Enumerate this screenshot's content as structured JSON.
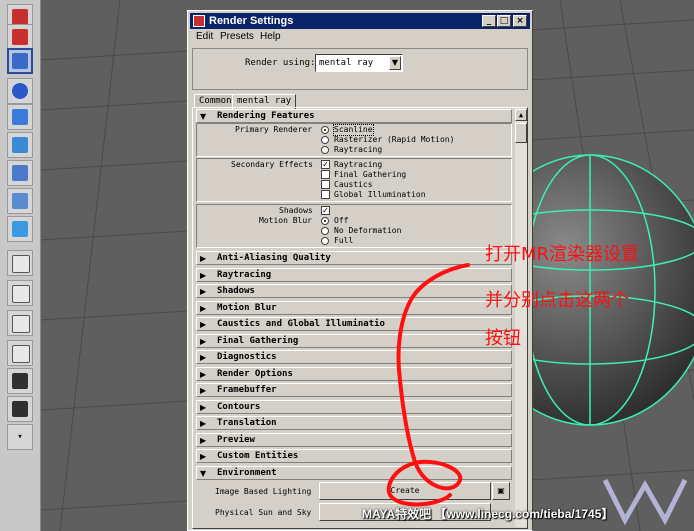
{
  "window": {
    "title": "Render Settings",
    "min_label": "_",
    "max_label": "□",
    "close_label": "×"
  },
  "menu": [
    "Edit",
    "Presets",
    "Help"
  ],
  "render_using": {
    "label": "Render using:",
    "value": "mental ray"
  },
  "tabs": [
    {
      "label": "Common",
      "active": false
    },
    {
      "label": "mental ray",
      "active": true
    }
  ],
  "rendering_features": {
    "title": "Rendering Features",
    "primary_label": "Primary Renderer",
    "primary_options": [
      {
        "label": "Scanline",
        "selected": true
      },
      {
        "label": "Rasterizer (Rapid Motion)",
        "selected": false
      },
      {
        "label": "Raytracing",
        "selected": false
      }
    ],
    "secondary_label": "Secondary Effects",
    "secondary_options": [
      {
        "label": "Raytracing",
        "checked": true
      },
      {
        "label": "Final Gathering",
        "checked": false
      },
      {
        "label": "Caustics",
        "checked": false
      },
      {
        "label": "Global Illumination",
        "checked": false
      }
    ],
    "shadows_label": "Shadows",
    "shadows_checked": true,
    "motion_blur_label": "Motion Blur",
    "motion_blur_options": [
      {
        "label": "Off",
        "selected": true
      },
      {
        "label": "No Deformation",
        "selected": false
      },
      {
        "label": "Full",
        "selected": false
      }
    ]
  },
  "sections": [
    "Anti-Aliasing Quality",
    "Raytracing",
    "Shadows",
    "Motion Blur",
    "Caustics and Global Illuminatio",
    "Final Gathering",
    "Diagnostics",
    "Render Options",
    "Framebuffer",
    "Contours",
    "Translation",
    "Preview",
    "Custom Entities"
  ],
  "environment": {
    "title": "Environment",
    "ibl_label": "Image Based Lighting",
    "ibl_button": "Create",
    "sun_label": "Physical Sun and Sky"
  },
  "annotation": {
    "line1": "打开MR渲染器设置",
    "line2": "并分别点击这两个",
    "line3": "按钮"
  },
  "watermark": "MAYA特效吧 【www.linecg.com/tieba/1745】",
  "colors": {
    "accent_red": "#ff1010",
    "title_bar": "#0a246a",
    "sphere_wire": "#3cf0b0"
  }
}
